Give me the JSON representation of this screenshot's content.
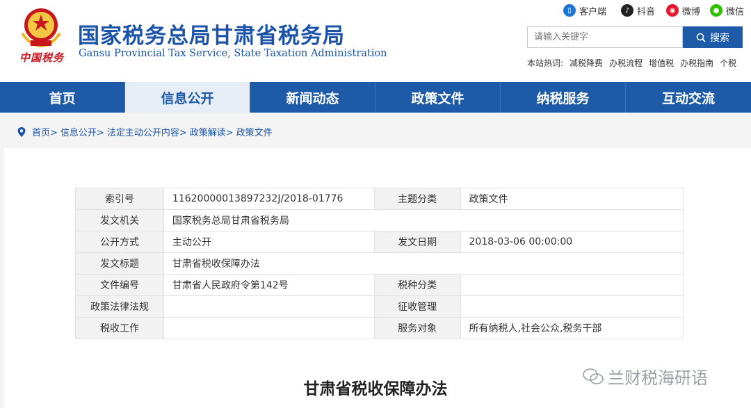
{
  "header": {
    "emblem_text": "中国税务",
    "title": "国家税务总局甘肃省税务局",
    "subtitle": "Gansu Provincial Tax Service, State Taxation Administration",
    "social": [
      {
        "label": "客户端",
        "icon": "mobile-client-icon",
        "color": "#1d74d4"
      },
      {
        "label": "抖音",
        "icon": "douyin-icon",
        "color": "#222222"
      },
      {
        "label": "微博",
        "icon": "weibo-icon",
        "color": "#e6162d"
      },
      {
        "label": "微信",
        "icon": "wechat-icon",
        "color": "#2dc100"
      }
    ],
    "search": {
      "placeholder": "请输入关键字",
      "button": "搜索"
    },
    "hot": {
      "label": "本站热词:",
      "words": [
        "减税降费",
        "办税流程",
        "增值税",
        "办税指南",
        "个税"
      ]
    }
  },
  "nav": {
    "items": [
      "首页",
      "信息公开",
      "新闻动态",
      "政策文件",
      "纳税服务",
      "互动交流"
    ],
    "active_index": 1
  },
  "breadcrumb": [
    "首页>",
    "信息公开>",
    "法定主动公开内容>",
    "政策解读>",
    "政策文件"
  ],
  "meta": {
    "rows": [
      {
        "k1": "索引号",
        "v1": "11620000013897232J/2018-01776",
        "k2": "主题分类",
        "v2": "政策文件"
      },
      {
        "k1": "发文机关",
        "v1": "国家税务总局甘肃省税务局",
        "k2": "",
        "v2": ""
      },
      {
        "k1": "公开方式",
        "v1": "主动公开",
        "k2": "发文日期",
        "v2": "2018-03-06 00:00:00"
      },
      {
        "k1": "发文标题",
        "v1": "甘肃省税收保障办法",
        "k2": "",
        "v2": ""
      },
      {
        "k1": "文件编号",
        "v1": "甘肃省人民政府令第142号",
        "k2": "税种分类",
        "v2": ""
      },
      {
        "k1": "政策法律法规",
        "v1": "",
        "k2": "征收管理",
        "v2": ""
      },
      {
        "k1": "税收工作",
        "v1": "",
        "k2": "服务对象",
        "v2": "所有纳税人,社会公众,税务干部"
      }
    ]
  },
  "doc_title": "甘肃省税收保障办法",
  "watermark": "兰财税海研语",
  "colors": {
    "brand_blue": "#1d5ba8",
    "nav_active_bg": "#e6edf7",
    "emblem_red": "#c8161d"
  }
}
